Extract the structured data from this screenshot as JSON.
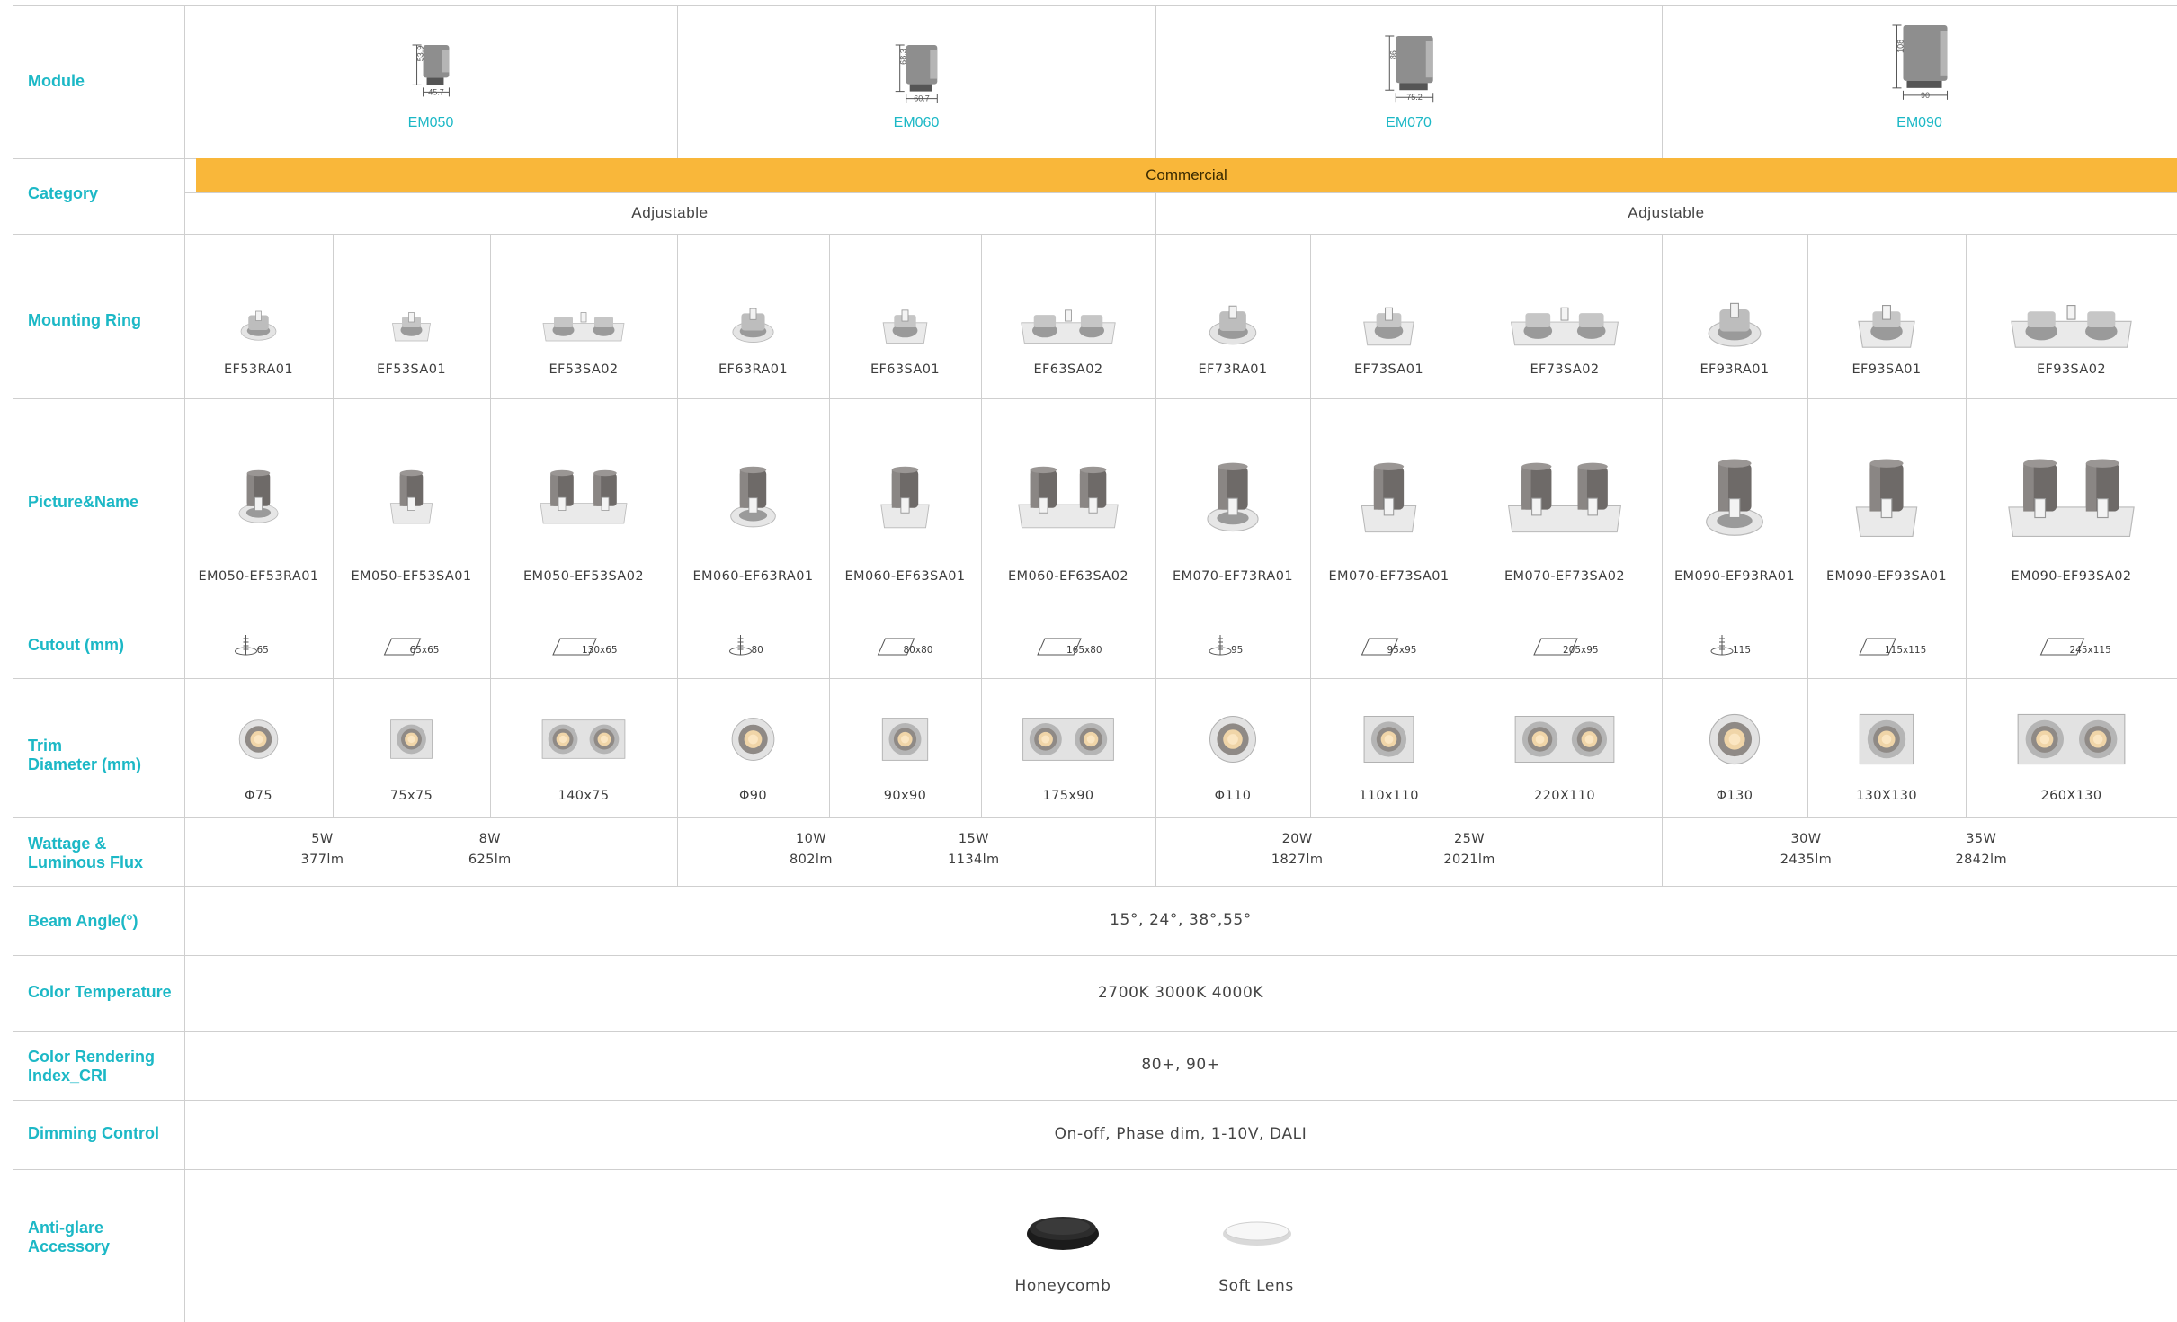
{
  "labels": {
    "module": "Module",
    "category": "Category",
    "mounting_ring": "Mounting Ring",
    "picture_name": "Picture&Name",
    "cutout": "Cutout (mm)",
    "trim_line1": "Trim",
    "trim_line2": "Diameter (mm)",
    "wattage_line1": "Wattage &",
    "wattage_line2": "Luminous Flux",
    "beam": "Beam Angle(°)",
    "color_temp": "Color Temperature",
    "cri_line1": "Color Rendering",
    "cri_line2": "Index_CRI",
    "dimming": "Dimming Control",
    "antiglare_line1": "Anti-glare",
    "antiglare_line2": "Accessory"
  },
  "modules": [
    {
      "name": "EM050",
      "height": "53.9",
      "width": "45.7"
    },
    {
      "name": "EM060",
      "height": "68.3",
      "width": "60.7"
    },
    {
      "name": "EM070",
      "height": "86",
      "width": "75.2"
    },
    {
      "name": "EM090",
      "height": "108",
      "width": "90"
    }
  ],
  "category": {
    "commercial": "Commercial",
    "group1": "Adjustable",
    "group2": "Adjustable"
  },
  "rings": [
    "EF53RA01",
    "EF53SA01",
    "EF53SA02",
    "EF63RA01",
    "EF63SA01",
    "EF63SA02",
    "EF73RA01",
    "EF73SA01",
    "EF73SA02",
    "EF93RA01",
    "EF93SA01",
    "EF93SA02"
  ],
  "pictures": [
    "EM050-EF53RA01",
    "EM050-EF53SA01",
    "EM050-EF53SA02",
    "EM060-EF63RA01",
    "EM060-EF63SA01",
    "EM060-EF63SA02",
    "EM070-EF73RA01",
    "EM070-EF73SA01",
    "EM070-EF73SA02",
    "EM090-EF93RA01",
    "EM090-EF93SA01",
    "EM090-EF93SA02"
  ],
  "cutouts": [
    "65",
    "65x65",
    "130x65",
    "80",
    "80x80",
    "165x80",
    "95",
    "95x95",
    "205x95",
    "115",
    "115x115",
    "245x115"
  ],
  "trims": [
    "Φ75",
    "75x75",
    "140x75",
    "Φ90",
    "90x90",
    "175x90",
    "Φ110",
    "110x110",
    "220X110",
    "Φ130",
    "130X130",
    "260X130"
  ],
  "wattage": [
    {
      "w1": "5W",
      "l1": "377lm",
      "w2": "8W",
      "l2": "625lm"
    },
    {
      "w1": "10W",
      "l1": "802lm",
      "w2": "15W",
      "l2": "1134lm"
    },
    {
      "w1": "20W",
      "l1": "1827lm",
      "w2": "25W",
      "l2": "2021lm"
    },
    {
      "w1": "30W",
      "l1": "2435lm",
      "w2": "35W",
      "l2": "2842lm"
    }
  ],
  "beam": "15°, 24°, 38°,55°",
  "color_temp": "2700K  3000K  4000K",
  "cri": "80+, 90+",
  "dimming": "On-off, Phase dim, 1-10V, DALI",
  "accessories": {
    "honeycomb": "Honeycomb",
    "soft_lens": "Soft Lens"
  }
}
